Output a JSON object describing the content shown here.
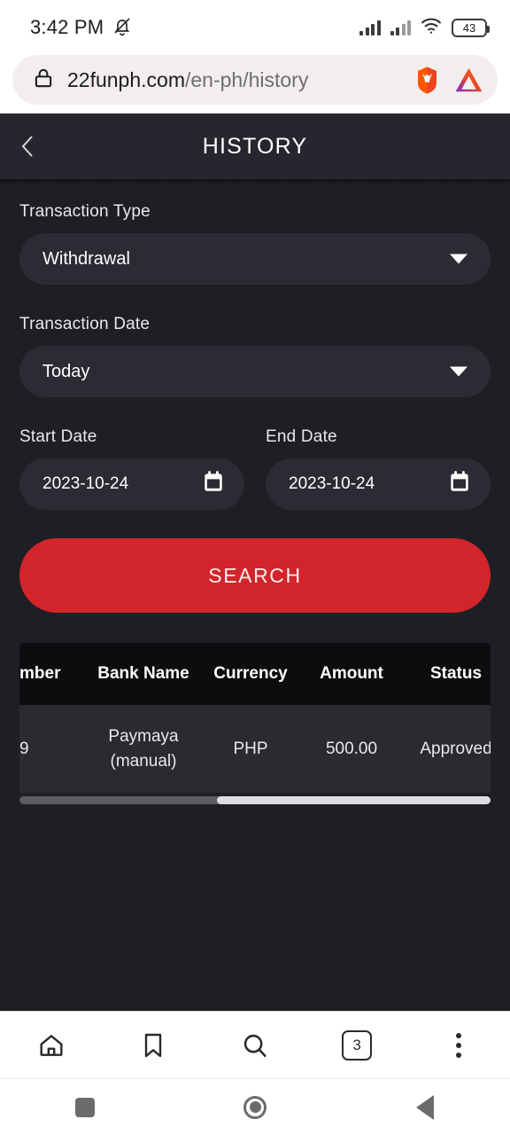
{
  "status_bar": {
    "time": "3:42 PM",
    "silent_icon": "bell-slash-icon",
    "signal_icon": "signal-bars-icon",
    "wifi_icon": "wifi-icon",
    "battery_level": "43"
  },
  "browser": {
    "lock_icon": "lock-icon",
    "url_domain": "22funph.com",
    "url_path": "/en-ph/history",
    "brave_shield_icon": "brave-lion-icon",
    "bat_icon": "bat-triangle-icon",
    "bottom_bar": {
      "home_icon": "home-icon",
      "bookmark_icon": "bookmark-icon",
      "search_icon": "search-icon",
      "tab_count": "3",
      "menu_icon": "more-vertical-icon"
    }
  },
  "android_nav": {
    "recents_icon": "square-recents-icon",
    "home_icon": "circle-home-icon",
    "back_icon": "triangle-back-icon"
  },
  "app": {
    "back_icon": "chevron-left-icon",
    "title": "HISTORY",
    "accent_color": "#d1252b",
    "background_color": "#1e1f25",
    "form": {
      "transaction_type_label": "Transaction Type",
      "transaction_type_value": "Withdrawal",
      "transaction_date_label": "Transaction Date",
      "transaction_date_value": "Today",
      "start_date_label": "Start Date",
      "start_date_value": "2023-10-24",
      "end_date_label": "End Date",
      "end_date_value": "2023-10-24",
      "calendar_icon": "calendar-icon",
      "dropdown_icon": "caret-down-icon",
      "search_button": "SEARCH"
    },
    "table": {
      "columns": [
        "mber",
        "Bank Name",
        "Currency",
        "Amount",
        "Status"
      ],
      "rows": [
        {
          "number": "9",
          "bank_name": "Paymaya (manual)",
          "currency": "PHP",
          "amount": "500.00",
          "status": "Approved"
        }
      ]
    }
  }
}
